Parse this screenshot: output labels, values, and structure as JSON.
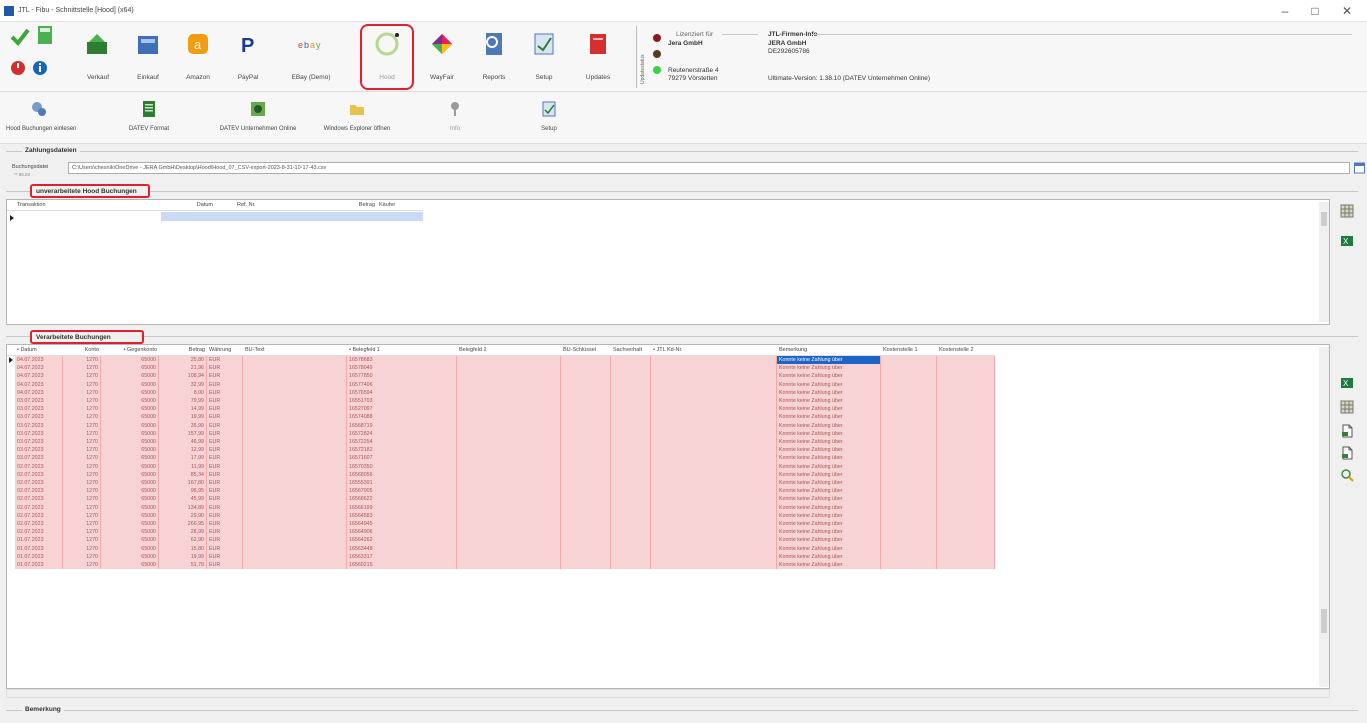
{
  "window": {
    "title": "JTL - Fibu - Schnittstelle [Hood] (x64)",
    "minimize": "–",
    "maximize": "□",
    "close": "✕"
  },
  "toolbar": [
    {
      "label": "",
      "icon": "check-icon"
    },
    {
      "label": "Verkauf",
      "icon": "verkauf-icon"
    },
    {
      "label": "Einkauf",
      "icon": "einkauf-icon"
    },
    {
      "label": "Amazon",
      "icon": "amazon-icon"
    },
    {
      "label": "PayPal",
      "icon": "paypal-icon"
    },
    {
      "label": "EBay (Demo)",
      "icon": "ebay-icon"
    },
    {
      "label": "Hood",
      "icon": "hood-icon"
    },
    {
      "label": "WayFair",
      "icon": "wayfair-icon"
    },
    {
      "label": "Reports",
      "icon": "reports-icon"
    },
    {
      "label": "Setup",
      "icon": "setup-icon"
    },
    {
      "label": "Updates",
      "icon": "updates-icon"
    }
  ],
  "license": {
    "vertical_label": "Updatestatus",
    "licensed_for_label": "Lizenziert für",
    "company": "Jera GmbH",
    "street": "Reutenerstraße 4",
    "city": "79279 Vörstetten",
    "firm_info_label": "JTL-Firmen-Info",
    "firm_name": "JERA GmbH",
    "vat_id": "DE292605786",
    "version": "Ultimate-Version: 1.38.10 (DATEV Unternehmen Online)"
  },
  "toolbar2": [
    {
      "label": "Hood Buchungen einlesen",
      "icon": "import-icon"
    },
    {
      "label": "DATEV Format",
      "icon": "datev-format-icon"
    },
    {
      "label": "DATEV Unternehmen Online",
      "icon": "datev-online-icon"
    },
    {
      "label": "Windows Explorer öffnen",
      "icon": "folder-icon"
    },
    {
      "label": "Info",
      "icon": "info-icon"
    },
    {
      "label": "Setup",
      "icon": "setup-icon"
    }
  ],
  "zahlungsdateien": {
    "title": "Zahlungsdateien",
    "field_label": "Buchungsdatei",
    "field_sub": "** 96.03",
    "path": "C:\\Users\\chesnik\\OneDrive - JERA GmbH\\Desktop\\Hood\\Hood_07_CSV-export-2023-8-31-10-17-43.csv"
  },
  "unverarbeitet": {
    "title": "unverarbeitete Hood Buchungen",
    "columns": [
      "Transaktion",
      "Datum",
      "Ref. Nr.",
      "Betrag",
      "Käufer"
    ]
  },
  "verarbeitet": {
    "title": "Verarbeitete Buchungen",
    "columns": [
      "• Datum",
      "Konto",
      "• Gegenkonto",
      "Betrag",
      "Währung",
      "BU-Text",
      "• Belegfeld 1",
      "Belegfeld 2",
      "BU-Schlüssel",
      "Sachverhalt",
      "• JTL Kd-Nr.",
      "Bemerkung",
      "Kostenstelle 1",
      "Kostenstelle 2"
    ],
    "rows": [
      [
        "04.07.2023",
        "1270",
        "65000",
        "25,80",
        "EUR",
        "16578683",
        "Konnte keine Zahlung über"
      ],
      [
        "04.07.2023",
        "1270",
        "65000",
        "21,96",
        "EUR",
        "16578049",
        "Konnte keine Zahlung über"
      ],
      [
        "04.07.2023",
        "1270",
        "65000",
        "108,94",
        "EUR",
        "16577850",
        "Konnte keine Zahlung über"
      ],
      [
        "04.07.2023",
        "1270",
        "65000",
        "32,99",
        "EUR",
        "16577406",
        "Konnte keine Zahlung über"
      ],
      [
        "04.07.2023",
        "1270",
        "65000",
        "8,00",
        "EUR",
        "16576594",
        "Konnte keine Zahlung über"
      ],
      [
        "03.07.2023",
        "1270",
        "65000",
        "79,99",
        "EUR",
        "16551703",
        "Konnte keine Zahlung über"
      ],
      [
        "03.07.2023",
        "1270",
        "65000",
        "14,99",
        "EUR",
        "16527097",
        "Konnte keine Zahlung über"
      ],
      [
        "03.07.2023",
        "1270",
        "65000",
        "19,99",
        "EUR",
        "16574088",
        "Konnte keine Zahlung über"
      ],
      [
        "03.07.2023",
        "1270",
        "65000",
        "35,99",
        "EUR",
        "16568719",
        "Konnte keine Zahlung über"
      ],
      [
        "03.07.2023",
        "1270",
        "65000",
        "157,99",
        "EUR",
        "16572824",
        "Konnte keine Zahlung über"
      ],
      [
        "03.07.2023",
        "1270",
        "65000",
        "46,99",
        "EUR",
        "16572254",
        "Konnte keine Zahlung über"
      ],
      [
        "03.07.2023",
        "1270",
        "65000",
        "12,99",
        "EUR",
        "16572182",
        "Konnte keine Zahlung über"
      ],
      [
        "03.07.2023",
        "1270",
        "65000",
        "17,99",
        "EUR",
        "16571607",
        "Konnte keine Zahlung über"
      ],
      [
        "02.07.2023",
        "1270",
        "65000",
        "11,99",
        "EUR",
        "16570350",
        "Konnte keine Zahlung über"
      ],
      [
        "02.07.2023",
        "1270",
        "65000",
        "85,34",
        "EUR",
        "16568056",
        "Konnte keine Zahlung über"
      ],
      [
        "02.07.2023",
        "1270",
        "65000",
        "167,80",
        "EUR",
        "16555391",
        "Konnte keine Zahlung über"
      ],
      [
        "02.07.2023",
        "1270",
        "65000",
        "96,95",
        "EUR",
        "16567005",
        "Konnte keine Zahlung über"
      ],
      [
        "02.07.2023",
        "1270",
        "65000",
        "45,99",
        "EUR",
        "16568622",
        "Konnte keine Zahlung über"
      ],
      [
        "02.07.2023",
        "1270",
        "65000",
        "134,89",
        "EUR",
        "16566199",
        "Konnte keine Zahlung über"
      ],
      [
        "02.07.2023",
        "1270",
        "65000",
        "29,90",
        "EUR",
        "16564583",
        "Konnte keine Zahlung über"
      ],
      [
        "02.07.2023",
        "1270",
        "65000",
        "266,95",
        "EUR",
        "16564945",
        "Konnte keine Zahlung über"
      ],
      [
        "02.07.2023",
        "1270",
        "65000",
        "28,99",
        "EUR",
        "16564906",
        "Konnte keine Zahlung über"
      ],
      [
        "01.07.2023",
        "1270",
        "65000",
        "62,90",
        "EUR",
        "16564262",
        "Konnte keine Zahlung über"
      ],
      [
        "01.07.2023",
        "1270",
        "65000",
        "15,80",
        "EUR",
        "16563448",
        "Konnte keine Zahlung über"
      ],
      [
        "01.07.2023",
        "1270",
        "65000",
        "19,99",
        "EUR",
        "16563317",
        "Konnte keine Zahlung über"
      ],
      [
        "01.07.2023",
        "1270",
        "65000",
        "51,78",
        "EUR",
        "16560215",
        "Konnte keine Zahlung über"
      ]
    ]
  },
  "bemerkung": {
    "title": "Bemerkung"
  },
  "colors": {
    "row_pink": "#f8d3d5",
    "selection_blue": "#1e64c8",
    "highlight_red": "#e0202c"
  }
}
